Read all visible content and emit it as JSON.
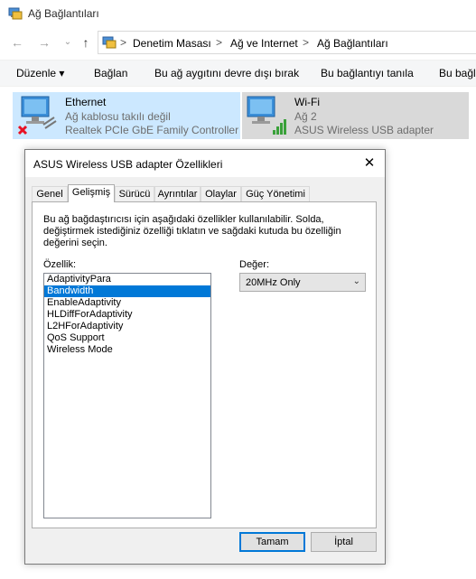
{
  "window": {
    "title": "Ağ Bağlantıları"
  },
  "breadcrumb": {
    "items": [
      "Denetim Masası",
      "Ağ ve Internet",
      "Ağ Bağlantıları"
    ],
    "separator": ">"
  },
  "command_bar": {
    "organize": "Düzenle ▾",
    "connect": "Bağlan",
    "disable": "Bu ağ aygıtını devre dışı bırak",
    "diagnose": "Bu bağlantıyı tanıla",
    "rename_partial": "Bu bağl"
  },
  "adapters": [
    {
      "name": "Ethernet",
      "status": "Ağ kablosu takılı değil",
      "device": "Realtek PCIe GbE Family Controller",
      "icon": "ethernet-disconnected-icon"
    },
    {
      "name": "Wi-Fi",
      "status": "Ağ 2",
      "device": "ASUS Wireless USB adapter",
      "icon": "wifi-adapter-icon"
    }
  ],
  "dialog": {
    "title": "ASUS Wireless USB adapter Özellikleri",
    "close": "✕",
    "tabs": [
      "Genel",
      "Gelişmiş",
      "Sürücü",
      "Ayrıntılar",
      "Olaylar",
      "Güç Yönetimi"
    ],
    "active_tab": "Gelişmiş",
    "description": "Bu ağ bağdaştırıcısı için aşağıdaki özellikler kullanılabilir. Solda, değiştirmek istediğiniz özelliği tıklatın ve sağdaki kutuda bu özelliğin değerini seçin.",
    "property_label": "Özellik:",
    "value_label": "Değer:",
    "properties": [
      "AdaptivityPara",
      "Bandwidth",
      "EnableAdaptivity",
      "HLDiffForAdaptivity",
      "L2HForAdaptivity",
      "QoS Support",
      "Wireless Mode"
    ],
    "selected_property": "Bandwidth",
    "value": "20MHz Only",
    "ok_label": "Tamam",
    "cancel_label": "İptal"
  },
  "colors": {
    "selection": "#0078d7",
    "ethernet_bg": "#cce8ff",
    "wifi_bg": "#d9d9d9",
    "error_red": "#e81123",
    "signal_green": "#3aa13a"
  }
}
